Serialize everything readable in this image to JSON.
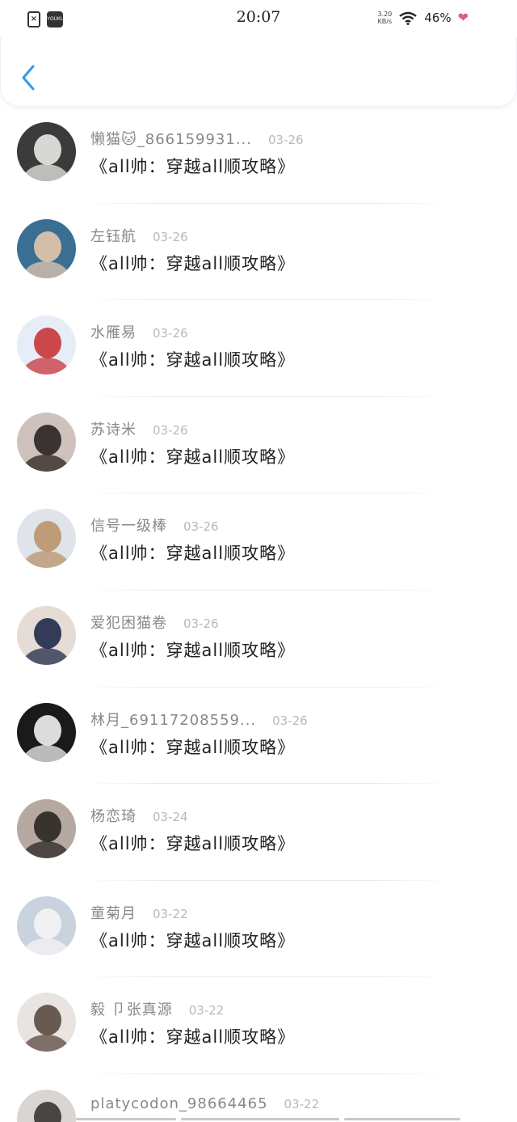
{
  "status_bar": {
    "time": "20:07",
    "net_speed_value": "3.20",
    "net_speed_unit": "KB/s",
    "battery": "46%",
    "app_icon_label": "YOUKU"
  },
  "nav": {
    "back_icon": "chevron-left-icon"
  },
  "comments": [
    {
      "user": "懒猫🐱_866159931...",
      "date": "03-26",
      "text": "《all帅：穿越all顺攻略》",
      "avatar": {
        "bg": "#3b3b3b",
        "fg": "#e9e9e6"
      }
    },
    {
      "user": "左钰航",
      "date": "03-26",
      "text": "《all帅：穿越all顺攻略》",
      "avatar": {
        "bg": "#3a6f93",
        "fg": "#e4c6ad"
      }
    },
    {
      "user": "水雁易",
      "date": "03-26",
      "text": "《all帅：穿越all顺攻略》",
      "avatar": {
        "bg": "#e6edf6",
        "fg": "#c8343a"
      }
    },
    {
      "user": "苏诗米",
      "date": "03-26",
      "text": "《all帅：穿越all顺攻略》",
      "avatar": {
        "bg": "#cfc2bd",
        "fg": "#2a2222"
      }
    },
    {
      "user": "信号一级棒",
      "date": "03-26",
      "text": "《all帅：穿越all顺攻略》",
      "avatar": {
        "bg": "#dfe3ea",
        "fg": "#b9936a"
      }
    },
    {
      "user": "爱犯困猫卷",
      "date": "03-26",
      "text": "《all帅：穿越all顺攻略》",
      "avatar": {
        "bg": "#e5ddd5",
        "fg": "#1e2a4a"
      }
    },
    {
      "user": "林月_69117208559...",
      "date": "03-26",
      "text": "《all帅：穿越all顺攻略》",
      "avatar": {
        "bg": "#1a1a1a",
        "fg": "#f2f2f2"
      }
    },
    {
      "user": "杨恋琦",
      "date": "03-24",
      "text": "《all帅：穿越all顺攻略》",
      "avatar": {
        "bg": "#b5a9a2",
        "fg": "#2b2624"
      }
    },
    {
      "user": "童菊月",
      "date": "03-22",
      "text": "《all帅：穿越all顺攻略》",
      "avatar": {
        "bg": "#c9d3de",
        "fg": "#f4f4f4"
      }
    },
    {
      "user": "毅 卩张真源",
      "date": "03-22",
      "text": "《all帅：穿越all顺攻略》",
      "avatar": {
        "bg": "#e9e4df",
        "fg": "#5a4a40"
      }
    },
    {
      "user": "platycodon_98664465",
      "date": "03-22",
      "text": "",
      "avatar": {
        "bg": "#d8d5d2",
        "fg": "#3a3533"
      }
    }
  ]
}
